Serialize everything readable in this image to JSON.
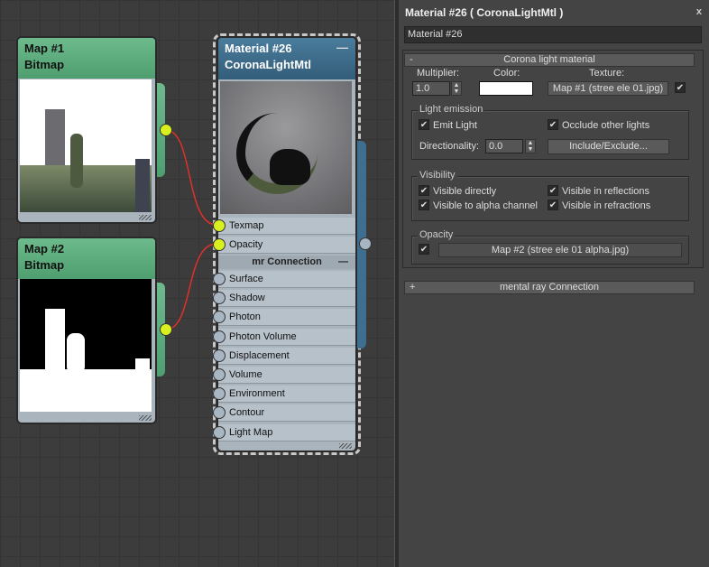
{
  "nodes": {
    "map1": {
      "title": "Map #1",
      "type": "Bitmap"
    },
    "map2": {
      "title": "Map #2",
      "type": "Bitmap"
    },
    "material": {
      "title": "Material #26",
      "type": "CoronaLightMtl",
      "collapse": "—",
      "slots": [
        "Texmap",
        "Opacity"
      ],
      "section": "mr Connection",
      "section_toggle": "—",
      "mr_slots": [
        "Surface",
        "Shadow",
        "Photon",
        "Photon Volume",
        "Displacement",
        "Volume",
        "Environment",
        "Contour",
        "Light Map"
      ]
    }
  },
  "panel": {
    "title": "Material #26  ( CoronaLightMtl )",
    "close": "x",
    "name_value": "Material #26",
    "rollout": {
      "toggle": "-",
      "title": "Corona light material",
      "multiplier_label": "Multiplier:",
      "multiplier_value": "1.0",
      "color_label": "Color:",
      "color_value": "#ffffff",
      "texture_label": "Texture:",
      "texture_button": "Map #1 (stree ele 01.jpg)",
      "texture_enabled": true,
      "light_emission": {
        "label": "Light emission",
        "emit_light": "Emit Light",
        "occlude": "Occlude other lights",
        "directionality_label": "Directionality:",
        "directionality_value": "0.0",
        "include_exclude": "Include/Exclude..."
      },
      "visibility": {
        "label": "Visibility",
        "directly": "Visible directly",
        "reflections": "Visible in reflections",
        "alpha": "Visible to alpha channel",
        "refractions": "Visible in refractions"
      },
      "opacity": {
        "label": "Opacity",
        "map_button": "Map #2 (stree ele 01 alpha.jpg)"
      }
    },
    "mr_rollout": {
      "toggle": "+",
      "title": "mental ray Connection"
    },
    "check": "✔"
  }
}
